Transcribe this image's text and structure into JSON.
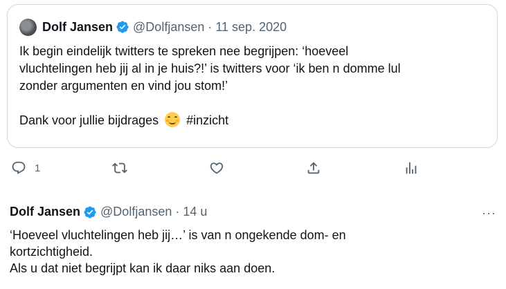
{
  "quoted_tweet": {
    "author_name": "Dolf Jansen",
    "handle": "@Dolfjansen",
    "separator": "·",
    "date": "11 sep. 2020",
    "lines": [
      "Ik begin eindelijk twitters te spreken nee begrijpen: ‘hoeveel",
      "vluchtelingen heb jij al in je huis?!’ is twitters voor ‘ik ben n domme lul",
      "zonder argumenten en vind jou stom!’"
    ],
    "closing_text": "Dank voor jullie bijdrages",
    "emoji": "smiling-face-with-smiling-eyes",
    "hashtag": "#inzicht"
  },
  "actions": {
    "reply_count": "1",
    "icons": [
      "reply-icon",
      "retweet-icon",
      "like-icon",
      "share-icon",
      "analytics-icon"
    ]
  },
  "reply_tweet": {
    "author_name": "Dolf Jansen",
    "handle": "@Dolfjansen",
    "separator": "·",
    "time": "14 u",
    "more": "···",
    "lines": [
      "‘Hoeveel vluchtelingen heb jij…’ is van n ongekende dom- en",
      "kortzichtigheid.",
      "Als u dat niet begrijpt kan ik daar niks aan doen."
    ]
  },
  "colors": {
    "verified": "#1d9bf0",
    "secondary_text": "#536471",
    "border": "#cfd9de"
  }
}
